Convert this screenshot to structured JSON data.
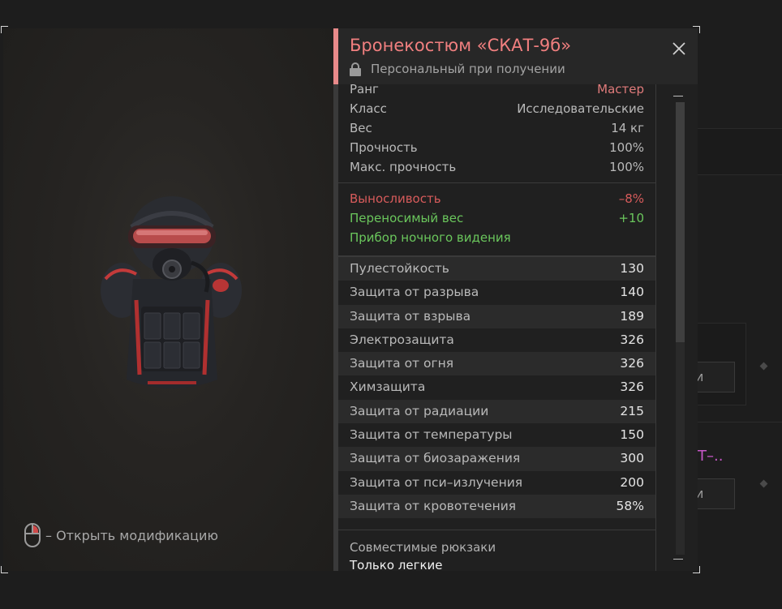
{
  "background": {
    "button1_label": "и",
    "button2_label": "и",
    "pink_title": "Т–..",
    "pink_color": "#c757c8"
  },
  "item": {
    "title": "Бронекостюм «СКАТ-9б»",
    "binding": "Персональный при получении",
    "title_color": "#f07f7f"
  },
  "hint": {
    "text": "– Открыть модификацию"
  },
  "info": [
    {
      "label": "Ранг",
      "value": "Мастер",
      "value_color": "#e07b7b"
    },
    {
      "label": "Класс",
      "value": "Исследовательские"
    },
    {
      "label": "Вес",
      "value": "14 кг"
    },
    {
      "label": "Прочность",
      "value": "100%"
    },
    {
      "label": "Макс. прочность",
      "value": "100%"
    }
  ],
  "effects": [
    {
      "label": "Выносливость",
      "value": "–8%",
      "color": "#d75b5b"
    },
    {
      "label": "Переносимый вес",
      "value": "+10",
      "color": "#6ac65c"
    },
    {
      "label": "Прибор ночного видения",
      "value": "",
      "color": "#6ac65c"
    }
  ],
  "protection": [
    {
      "label": "Пулестойкость",
      "value": "130"
    },
    {
      "label": "Защита от разрыва",
      "value": "140"
    },
    {
      "label": "Защита от взрыва",
      "value": "189"
    },
    {
      "label": "Электрозащита",
      "value": "326"
    },
    {
      "label": "Защита от огня",
      "value": "326"
    },
    {
      "label": "Химзащита",
      "value": "326"
    },
    {
      "label": "Защита от радиации",
      "value": "215"
    },
    {
      "label": "Защита от температуры",
      "value": "150"
    },
    {
      "label": "Защита от биозаражения",
      "value": "300"
    },
    {
      "label": "Защита от пси–излучения",
      "value": "200"
    },
    {
      "label": "Защита от кровотечения",
      "value": "58%"
    }
  ],
  "compat": {
    "label": "Совместимые рюкзаки",
    "value": "Только легкие"
  },
  "scrollbar": {
    "position": 0
  }
}
